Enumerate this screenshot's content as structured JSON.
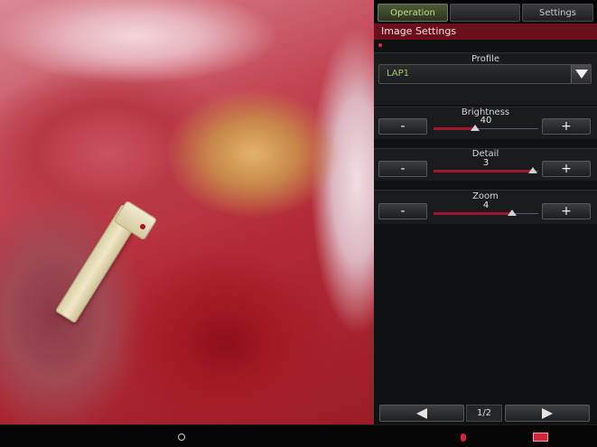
{
  "tabs": {
    "operation": "Operation",
    "middle": "",
    "settings": "Settings"
  },
  "section_title": "Image Settings",
  "profile": {
    "label": "Profile",
    "value": "LAP1"
  },
  "brightness": {
    "label": "Brightness",
    "value": "40",
    "minus": "-",
    "plus": "+",
    "level": 0.4
  },
  "detail": {
    "label": "Detail",
    "value": "3",
    "minus": "-",
    "plus": "+",
    "level": 0.95
  },
  "zoom": {
    "label": "Zoom",
    "value": "4",
    "minus": "-",
    "plus": "+",
    "level": 0.75
  },
  "pager": {
    "page": "1/2"
  },
  "colors": {
    "accent": "#6a0f1c",
    "active_tab_text": "#bfe27a"
  },
  "icons": {
    "status_left": "connection-icon",
    "status_mid": "record-icon",
    "status_right": "battery-icon"
  }
}
